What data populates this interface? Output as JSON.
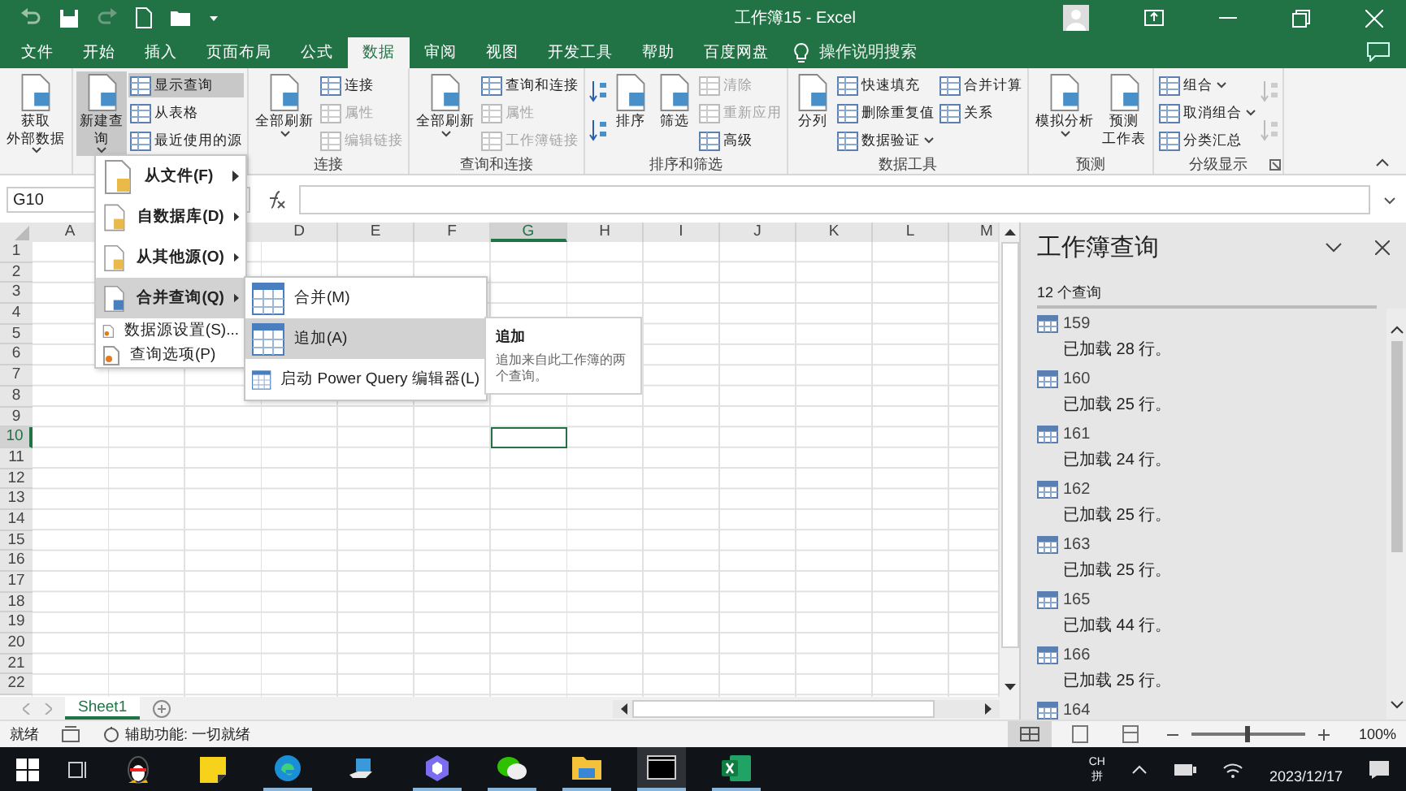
{
  "window": {
    "title": "工作簿15 - Excel"
  },
  "ribbon_tabs": [
    {
      "label": "文件",
      "selected": false
    },
    {
      "label": "开始",
      "selected": false
    },
    {
      "label": "插入",
      "selected": false
    },
    {
      "label": "页面布局",
      "selected": false
    },
    {
      "label": "公式",
      "selected": false
    },
    {
      "label": "数据",
      "selected": true
    },
    {
      "label": "审阅",
      "selected": false
    },
    {
      "label": "视图",
      "selected": false
    },
    {
      "label": "开发工具",
      "selected": false
    },
    {
      "label": "帮助",
      "selected": false
    },
    {
      "label": "百度网盘",
      "selected": false
    }
  ],
  "tell_me": {
    "placeholder": "操作说明搜索"
  },
  "ribbon_groups": [
    {
      "items": [
        {
          "kind": "large",
          "lines": [
            "获取",
            "外部数据"
          ],
          "dropdown": true
        }
      ]
    },
    {
      "items": [
        {
          "kind": "large",
          "lines": [
            "新建查",
            "询"
          ],
          "dropdown": true,
          "pressed": true
        },
        {
          "kind": "small",
          "label": "显示查询",
          "pressed": true
        },
        {
          "kind": "small",
          "label": "从表格"
        },
        {
          "kind": "small",
          "label": "最近使用的源"
        }
      ]
    },
    {
      "label": "连接",
      "items": [
        {
          "kind": "large",
          "lines": [
            "全部刷新"
          ],
          "dropdown": true
        },
        {
          "kind": "small",
          "label": "连接"
        },
        {
          "kind": "small",
          "label": "属性",
          "disabled": true
        },
        {
          "kind": "small",
          "label": "编辑链接",
          "disabled": true
        }
      ]
    },
    {
      "label": "查询和连接",
      "items": [
        {
          "kind": "large",
          "lines": [
            "全部刷新"
          ],
          "dropdown": true
        },
        {
          "kind": "small",
          "label": "查询和连接"
        },
        {
          "kind": "small",
          "label": "属性",
          "disabled": true
        },
        {
          "kind": "small",
          "label": "工作簿链接",
          "disabled": true
        }
      ]
    },
    {
      "label": "排序和筛选",
      "items": [
        {
          "kind": "icon"
        },
        {
          "kind": "icon"
        },
        {
          "kind": "large",
          "lines": [
            "排序"
          ]
        },
        {
          "kind": "large",
          "lines": [
            "筛选"
          ]
        },
        {
          "kind": "small",
          "label": "清除",
          "disabled": true
        },
        {
          "kind": "small",
          "label": "重新应用",
          "disabled": true
        },
        {
          "kind": "small",
          "label": "高级"
        }
      ]
    },
    {
      "label": "数据工具",
      "items": [
        {
          "kind": "large",
          "lines": [
            "分列"
          ]
        },
        {
          "kind": "small",
          "label": "快速填充"
        },
        {
          "kind": "small",
          "label": "删除重复值"
        },
        {
          "kind": "small",
          "label": "数据验证",
          "dropdown": true
        },
        {
          "kind": "small",
          "label": "合并计算"
        },
        {
          "kind": "small",
          "label": "关系"
        }
      ]
    },
    {
      "label": "预测",
      "items": [
        {
          "kind": "large",
          "lines": [
            "模拟分析"
          ],
          "dropdown": true
        },
        {
          "kind": "large",
          "lines": [
            "预测",
            "工作表"
          ]
        }
      ]
    },
    {
      "label": "分级显示",
      "launcher": true,
      "items": [
        {
          "kind": "small",
          "label": "组合",
          "dropdown": true
        },
        {
          "kind": "small",
          "label": "取消组合",
          "dropdown": true
        },
        {
          "kind": "small",
          "label": "分类汇总"
        },
        {
          "kind": "icon",
          "disabled": true
        },
        {
          "kind": "icon",
          "disabled": true
        }
      ]
    }
  ],
  "name_box": "G10",
  "columns": [
    {
      "label": "A",
      "selected": false
    },
    {},
    {},
    {
      "label": "D",
      "selected": false
    },
    {
      "label": "E",
      "selected": false
    },
    {
      "label": "F",
      "selected": false
    },
    {
      "label": "G",
      "selected": true
    },
    {
      "label": "H",
      "selected": false
    },
    {
      "label": "I",
      "selected": false
    },
    {
      "label": "J",
      "selected": false
    },
    {
      "label": "K",
      "selected": false
    },
    {
      "label": "L",
      "selected": false
    },
    {
      "label": "M",
      "selected": false
    }
  ],
  "rows": [
    {
      "label": "1",
      "selected": false
    },
    {
      "label": "2",
      "selected": false
    },
    {
      "label": "3",
      "selected": false
    },
    {
      "label": "4",
      "selected": false
    },
    {
      "label": "5",
      "selected": false
    },
    {
      "label": "6",
      "selected": false
    },
    {
      "label": "7",
      "selected": false
    },
    {
      "label": "8",
      "selected": false
    },
    {
      "label": "9",
      "selected": false
    },
    {
      "label": "10",
      "selected": true
    },
    {
      "label": "11",
      "selected": false
    },
    {
      "label": "12",
      "selected": false
    },
    {
      "label": "13",
      "selected": false
    },
    {
      "label": "14",
      "selected": false
    },
    {
      "label": "15",
      "selected": false
    },
    {
      "label": "16",
      "selected": false
    },
    {
      "label": "17",
      "selected": false
    },
    {
      "label": "18",
      "selected": false
    },
    {
      "label": "19",
      "selected": false
    },
    {
      "label": "20",
      "selected": false
    },
    {
      "label": "21",
      "selected": false
    },
    {
      "label": "22",
      "selected": false
    }
  ],
  "new_query_menu": [
    {
      "label": "从文件(F)",
      "kind": "large",
      "submenu": true,
      "selected": false
    },
    {
      "label": "自数据库(D)",
      "kind": "large",
      "submenu": true,
      "selected": false
    },
    {
      "label": "从其他源(O)",
      "kind": "large",
      "submenu": true,
      "selected": false
    },
    {
      "label": "合并查询(Q)",
      "kind": "large",
      "submenu": true,
      "selected": true
    },
    {
      "label": "数据源设置(S)...",
      "kind": "small",
      "submenu": false,
      "selected": false
    },
    {
      "label": "查询选项(P)",
      "kind": "small",
      "submenu": false,
      "selected": false
    }
  ],
  "combine_submenu": [
    {
      "label": "合并(M)",
      "selected": false
    },
    {
      "label": "追加(A)",
      "selected": true
    },
    {
      "label": "启动 Power Query 编辑器(L)",
      "selected": false
    }
  ],
  "tooltip": {
    "title": "追加",
    "text": "追加来自此工作簿的两个查询。"
  },
  "sheet_tabs": [
    {
      "label": "Sheet1",
      "selected": true
    }
  ],
  "queries_pane": {
    "title": "工作簿查询",
    "count": "12 个查询",
    "queries": [
      {
        "name": "159",
        "status": "已加载 28 行。"
      },
      {
        "name": "160",
        "status": "已加载 25 行。"
      },
      {
        "name": "161",
        "status": "已加载 24 行。"
      },
      {
        "name": "162",
        "status": "已加载 25 行。"
      },
      {
        "name": "163",
        "status": "已加载 25 行。"
      },
      {
        "name": "165",
        "status": "已加载 44 行。"
      },
      {
        "name": "166",
        "status": "已加载 25 行。"
      },
      {
        "name": "164"
      }
    ]
  },
  "status_bar": {
    "ready": "就绪",
    "accessibility": "辅助功能: 一切就绪",
    "zoom": "100%",
    "zoom_slider": {
      "level": 0.5
    }
  },
  "taskbar": {
    "apps": [
      {
        "running": false,
        "selected": false
      },
      {
        "running": false,
        "selected": false
      },
      {
        "running": true,
        "selected": false
      },
      {
        "running": false,
        "selected": false
      },
      {
        "running": true,
        "selected": false
      },
      {
        "running": true,
        "selected": false
      },
      {
        "running": true,
        "selected": false
      },
      {
        "running": true,
        "selected": true
      },
      {
        "running": true,
        "selected": false
      }
    ],
    "ime": [
      "CH",
      "拼"
    ],
    "date": "2023/12/17"
  }
}
